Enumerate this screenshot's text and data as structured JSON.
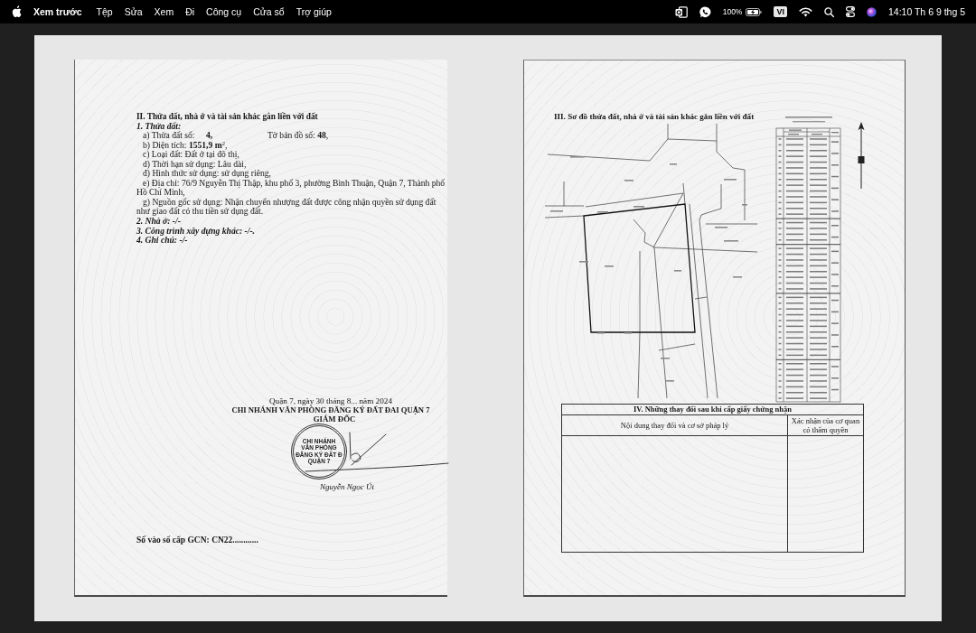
{
  "menu_bar": {
    "app_name": "Xem trước",
    "menus": [
      "Tệp",
      "Sửa",
      "Xem",
      "Đi",
      "Công cụ",
      "Cửa sổ",
      "Trợ giúp"
    ],
    "battery_text": "100%",
    "input_source": "VI",
    "clock": "14:10 Th 6 9 thg 5"
  },
  "land_details_page": {
    "section_title": "II. Thửa đất, nhà ở và tài sản khác gắn liền với đất",
    "land_parcel": {
      "heading": "1. Thửa đất:",
      "items": [
        {
          "kind": "pair",
          "text": "a) Thửa đất số:",
          "value": "4,",
          "aside": "Tờ bản đồ số: **48**,"
        },
        {
          "kind": "line",
          "text": "b) Diện tích: **1551,9 m**$^{2}$,"
        },
        {
          "kind": "line",
          "text": "c) Loại đất: Đất ở tại đô thị,"
        },
        {
          "kind": "line",
          "text": "d) Thời hạn sử dụng: Lâu dài,"
        },
        {
          "kind": "line",
          "text": "đ) Hình thức sử dụng: sử dụng riêng,"
        },
        {
          "kind": "line",
          "text": "e) Địa chỉ: 76/9 Nguyễn Thị Thập, khu phố 3, phường Bình Thuận, Quận 7, Thành phố Hồ Chí Minh,"
        },
        {
          "kind": "line",
          "text": "g) Nguồn gốc sử dụng: Nhận chuyển nhượng đất được công nhận quyền sử dụng đất như giao đất có thu tiền sử dụng đất."
        }
      ]
    },
    "other_items": [
      "2. Nhà ở: -/-",
      "3. Công trình xây dựng khác: -/-.",
      "4. Ghi chú: -/-"
    ],
    "signature": {
      "place_date": "Quận 7, ngày 30 tháng 8... năm 2024",
      "office": "CHI NHÁNH VĂN PHÒNG ĐĂNG KÝ ĐẤT ĐAI QUẬN 7",
      "title": "GIÁM ĐỐC",
      "stamp_lines": [
        "CHI NHÁNH",
        "VĂN PHÒNG",
        "ĐĂNG KÝ ĐẤT Đ",
        "QUẬN 7"
      ],
      "signer": "Nguyễn Ngọc Út"
    },
    "register_number": "Số vào sổ cấp GCN: CN22............"
  },
  "site_plan_page": {
    "section_title": "III. Sơ đồ thửa đất, nhà ở và tài sản khác gắn liền với đất",
    "changes_table": {
      "title": "IV. Những thay đổi sau khi cấp giấy chứng nhận",
      "columns": [
        "Nội dung thay đổi và cơ sở pháp lý",
        "Xác nhận của cơ quan có thẩm quyền"
      ]
    }
  }
}
